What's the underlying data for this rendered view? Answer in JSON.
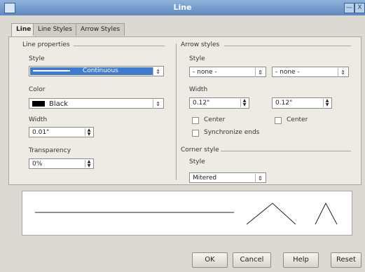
{
  "window": {
    "title": "Line"
  },
  "titlebar_buttons": [
    "—",
    "X"
  ],
  "tabs": [
    "Line",
    "Line Styles",
    "Arrow Styles"
  ],
  "line_properties": {
    "group_title": "Line properties",
    "style_label": "Style",
    "style_value": "Continuous",
    "color_label": "Color",
    "color_value": "Black",
    "width_label": "Width",
    "width_value": "0.01\"",
    "transparency_label": "Transparency",
    "transparency_value": "0%"
  },
  "arrow_styles": {
    "group_title": "Arrow styles",
    "style_label": "Style",
    "style_left": "- none -",
    "style_right": "- none -",
    "width_label": "Width",
    "width_left": "0.12\"",
    "width_right": "0.12\"",
    "center_left": "Center",
    "center_right": "Center",
    "sync_label": "Synchronize ends"
  },
  "corner_style": {
    "group_title": "Corner style",
    "style_label": "Style",
    "style_value": "Mitered"
  },
  "buttons": {
    "ok": "OK",
    "cancel": "Cancel",
    "help": "Help",
    "reset": "Reset"
  },
  "colors": {
    "accent": "#3f7ccf",
    "titlebar": "#6f95c8"
  },
  "icons": {
    "app": "app-icon",
    "minimize": "minimize-icon",
    "close": "close-icon"
  }
}
